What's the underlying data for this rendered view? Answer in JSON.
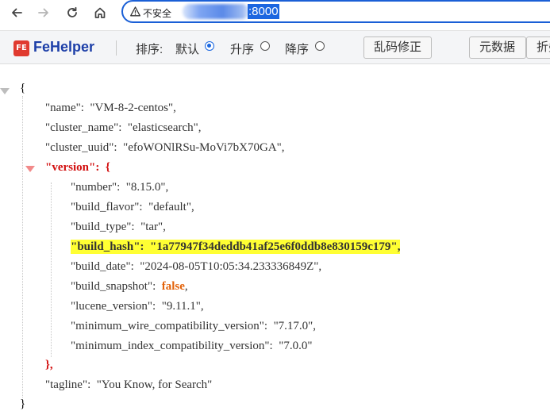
{
  "browser": {
    "security_label": "不安全",
    "url_port": ":8000"
  },
  "toolbar": {
    "brand": "FeHelper",
    "sort_label": "排序:",
    "sort_default": "默认",
    "sort_asc": "升序",
    "sort_desc": "降序",
    "fix_encoding_button": "乱码修正",
    "metadata_button": "元数据",
    "collapse_button": "折叠"
  },
  "json": {
    "open_brace": "{",
    "close_brace": "}",
    "name_key": "\"name\":",
    "name_value": "\"VM-8-2-centos\",",
    "cluster_name_key": "\"cluster_name\":",
    "cluster_name_value": "\"elasticsearch\",",
    "cluster_uuid_key": "\"cluster_uuid\":",
    "cluster_uuid_value": "\"efoWONlRSu-MoVi7bX70GA\",",
    "version_key": "\"version\":",
    "version_open": "{",
    "number_key": "\"number\":",
    "number_value": "\"8.15.0\",",
    "build_flavor_key": "\"build_flavor\":",
    "build_flavor_value": "\"default\",",
    "build_type_key": "\"build_type\":",
    "build_type_value": "\"tar\",",
    "build_hash_key": "\"build_hash\":",
    "build_hash_value": "\"1a77947f34deddb41af25e6f0ddb8e830159c179\",",
    "build_date_key": "\"build_date\":",
    "build_date_value": "\"2024-08-05T10:05:34.233336849Z\",",
    "build_snapshot_key": "\"build_snapshot\":",
    "build_snapshot_value": "false",
    "build_snapshot_comma": ",",
    "lucene_version_key": "\"lucene_version\":",
    "lucene_version_value": "\"9.11.1\",",
    "min_wire_key": "\"minimum_wire_compatibility_version\":",
    "min_wire_value": "\"7.17.0\",",
    "min_index_key": "\"minimum_index_compatibility_version\":",
    "min_index_value": "\"7.0.0\"",
    "version_close": "},",
    "tagline_key": "\"tagline\":",
    "tagline_value": "\"You Know, for Search\""
  }
}
